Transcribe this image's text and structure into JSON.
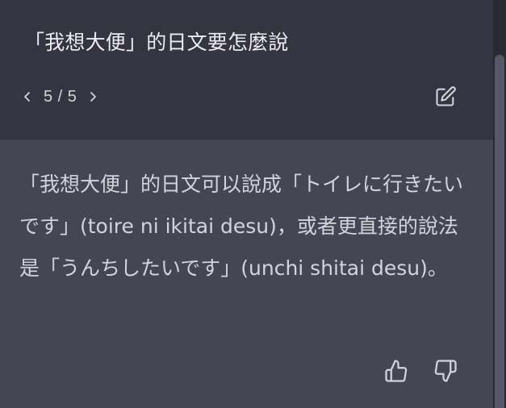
{
  "user_message": {
    "text": "「我想大便」的日文要怎麼說",
    "pager": {
      "current": "5 / 5",
      "prev_icon": "chevron-left-icon",
      "next_icon": "chevron-right-icon"
    },
    "edit_icon": "edit-icon"
  },
  "assistant_message": {
    "text": "「我想大便」的日文可以說成「トイレに行きたいです」(toire ni ikitai desu)，或者更直接的說法是「うんちしたいです」(unchi shitai desu)。",
    "thumbs_up_icon": "thumbs-up-icon",
    "thumbs_down_icon": "thumbs-down-icon"
  },
  "colors": {
    "user_bg": "#343541",
    "assistant_bg": "#444654",
    "text": "#d1d5db",
    "scrollbar_thumb": "#565869"
  }
}
